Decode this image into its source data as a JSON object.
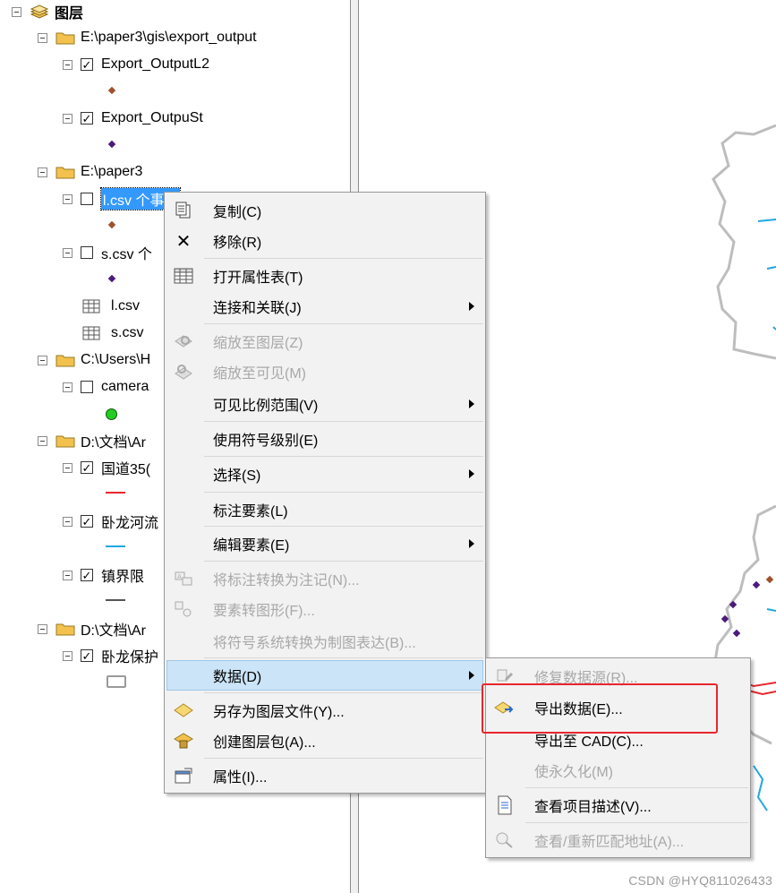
{
  "toc": {
    "root_label": "图层",
    "groups": [
      {
        "label": "E:\\paper3\\gis\\export_output"
      },
      {
        "label": "E:\\paper3"
      },
      {
        "label": "C:\\Users\\H"
      },
      {
        "label": "D:\\文档\\Ar"
      },
      {
        "label": "D:\\文档\\Ar"
      }
    ],
    "layers": [
      {
        "label": "Export_OutputL2",
        "checked": true
      },
      {
        "label": "Export_OutpuSt",
        "checked": true
      },
      {
        "label": "l.csv 个事件",
        "checked": false
      },
      {
        "label": "s.csv 个",
        "checked": false
      },
      {
        "label": "l.csv"
      },
      {
        "label": "s.csv"
      },
      {
        "label": "camera",
        "checked": false
      },
      {
        "label": "国道35(",
        "checked": true
      },
      {
        "label": "卧龙河流",
        "checked": true
      },
      {
        "label": "镇界限",
        "checked": true
      },
      {
        "label": "卧龙保护",
        "checked": true
      }
    ],
    "check_glyph": "✓"
  },
  "context_menu": {
    "items": [
      {
        "label": "复制(C)",
        "icon": "copy-icon",
        "enabled": true
      },
      {
        "label": "移除(R)",
        "icon": "remove-x-icon",
        "enabled": true
      },
      {
        "label": "打开属性表(T)",
        "icon": "table-icon",
        "enabled": true
      },
      {
        "label": "连接和关联(J)",
        "enabled": true,
        "submenu": true
      },
      {
        "label": "缩放至图层(Z)",
        "icon": "zoom-layer-icon",
        "enabled": false
      },
      {
        "label": "缩放至可见(M)",
        "icon": "zoom-visible-icon",
        "enabled": false
      },
      {
        "label": "可见比例范围(V)",
        "enabled": true,
        "submenu": true
      },
      {
        "label": "使用符号级别(E)",
        "enabled": true
      },
      {
        "label": "选择(S)",
        "enabled": true,
        "submenu": true
      },
      {
        "label": "标注要素(L)",
        "enabled": true
      },
      {
        "label": "编辑要素(E)",
        "enabled": true,
        "submenu": true
      },
      {
        "label": "将标注转换为注记(N)...",
        "icon": "convert-labels-icon",
        "enabled": false
      },
      {
        "label": "要素转图形(F)...",
        "icon": "feature-graphics-icon",
        "enabled": false
      },
      {
        "label": "将符号系统转换为制图表达(B)...",
        "enabled": false
      },
      {
        "label": "数据(D)",
        "enabled": true,
        "submenu": true,
        "highlighted": true
      },
      {
        "label": "另存为图层文件(Y)...",
        "icon": "layer-file-icon",
        "enabled": true
      },
      {
        "label": "创建图层包(A)...",
        "icon": "layer-package-icon",
        "enabled": true
      },
      {
        "label": "属性(I)...",
        "icon": "properties-icon",
        "enabled": true
      }
    ]
  },
  "data_submenu": {
    "items": [
      {
        "label": "修复数据源(R)...",
        "icon": "repair-source-icon",
        "enabled": false
      },
      {
        "label": "导出数据(E)...",
        "icon": "export-data-icon",
        "enabled": true
      },
      {
        "label": "导出至 CAD(C)...",
        "enabled": true
      },
      {
        "label": "使永久化(M)",
        "enabled": false
      },
      {
        "label": "查看项目描述(V)...",
        "icon": "item-description-icon",
        "enabled": true
      },
      {
        "label": "查看/重新匹配地址(A)...",
        "icon": "rematch-address-icon",
        "enabled": false
      }
    ]
  },
  "colors": {
    "selection": "#3399ff",
    "highlight": "#cce4f7",
    "annotation": "#e8262d",
    "folder": "#f2c14e",
    "map_boundary": "#bdbdbd",
    "river": "#1ea7e1",
    "road": "#e8262d"
  },
  "watermark": "CSDN @HYQ811026433"
}
